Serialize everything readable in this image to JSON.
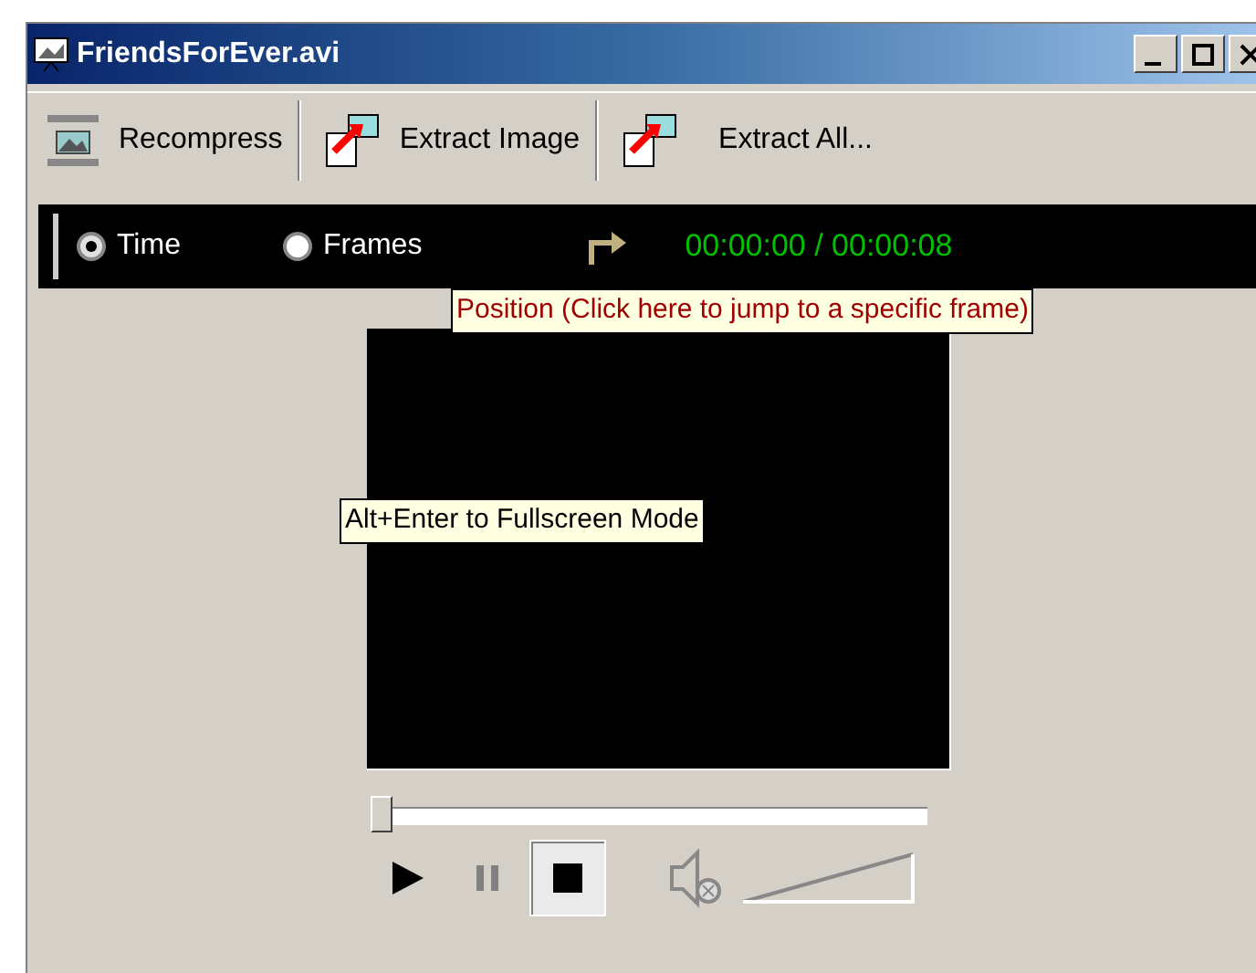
{
  "window": {
    "title": "FriendsForEver.avi"
  },
  "toolbar": [
    {
      "kind": "recompress",
      "label": "Recompress"
    },
    {
      "kind": "extract",
      "label": "Extract Image"
    },
    {
      "kind": "extract",
      "label": "Extract All..."
    }
  ],
  "mode": [
    {
      "label": "Time",
      "selected": true
    },
    {
      "label": "Frames",
      "selected": false
    }
  ],
  "position": {
    "text": "00:00:00 / 00:00:08",
    "tooltip": "Position (Click here to jump to a specific frame)"
  },
  "video": {
    "tooltip": "Alt+Enter to Fullscreen Mode"
  },
  "seek": {
    "level": 0
  },
  "controls": [
    {
      "kind": "play",
      "disabled": false,
      "selected": false
    },
    {
      "kind": "pause",
      "disabled": true,
      "selected": false
    },
    {
      "kind": "stop",
      "disabled": false,
      "selected": true
    }
  ],
  "volume": {
    "muted": true
  }
}
